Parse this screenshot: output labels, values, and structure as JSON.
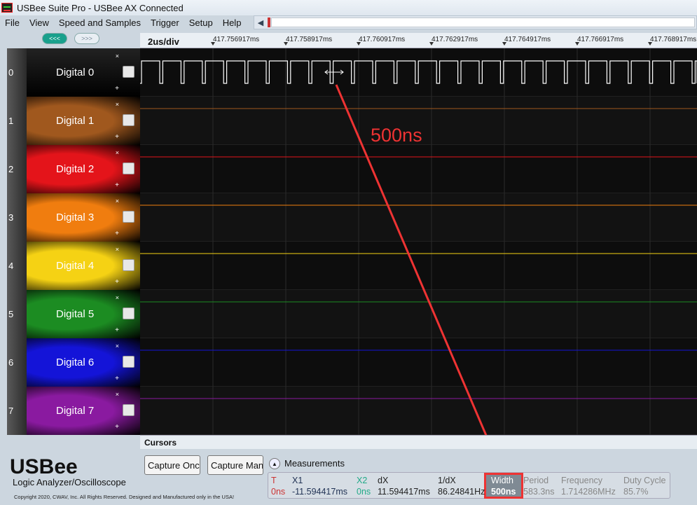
{
  "window": {
    "title": "USBee Suite Pro - USBee AX Connected"
  },
  "menu": [
    "File",
    "View",
    "Speed and Samples",
    "Trigger",
    "Setup",
    "Help"
  ],
  "nav": {
    "prev": "<<<",
    "next": ">>>"
  },
  "scale": "2us/div",
  "ticks": [
    "417.756917ms",
    "417.758917ms",
    "417.760917ms",
    "417.762917ms",
    "417.764917ms",
    "417.766917ms",
    "417.768917ms"
  ],
  "channels": [
    {
      "num": "0",
      "label": "Digital 0",
      "color": "#1a1a1a"
    },
    {
      "num": "1",
      "label": "Digital 1",
      "color": "#a0581e"
    },
    {
      "num": "2",
      "label": "Digital 2",
      "color": "#e4141a"
    },
    {
      "num": "3",
      "label": "Digital 3",
      "color": "#f07d0f"
    },
    {
      "num": "4",
      "label": "Digital 4",
      "color": "#f5d214"
    },
    {
      "num": "5",
      "label": "Digital 5",
      "color": "#1c8c22"
    },
    {
      "num": "6",
      "label": "Digital 6",
      "color": "#1414d8"
    },
    {
      "num": "7",
      "label": "Digital 7",
      "color": "#8a1aa0"
    }
  ],
  "trace_colors": [
    "#ffffff",
    "#a0581e",
    "#e4141a",
    "#f07d0f",
    "#f5d214",
    "#1c8c22",
    "#1414d8",
    "#8a1aa0"
  ],
  "annotation": "500ns",
  "cursors_title": "Cursors",
  "buttons": {
    "capture_once": "Capture Once",
    "capture_many": "Capture Many"
  },
  "measurements": {
    "title": "Measurements",
    "cols": [
      {
        "h": "T",
        "v": "0ns"
      },
      {
        "h": "X1",
        "v": "-11.594417ms"
      },
      {
        "h": "X2",
        "v": "0ns"
      },
      {
        "h": "dX",
        "v": "11.594417ms"
      },
      {
        "h": "1/dX",
        "v": "86.24841Hz"
      },
      {
        "h": "Width",
        "v": "500ns"
      },
      {
        "h": "Period",
        "v": "583.3ns"
      },
      {
        "h": "Frequency",
        "v": "1.714286MHz"
      },
      {
        "h": "Duty Cycle",
        "v": "85.7%"
      }
    ]
  },
  "brand": {
    "logo": "USBee",
    "subtitle": "Logic Analyzer/Oscilloscope",
    "copyright": "Copyright 2020, CWAV, Inc. All Rights Reserved. Designed and Manufactured only in the USA!"
  }
}
